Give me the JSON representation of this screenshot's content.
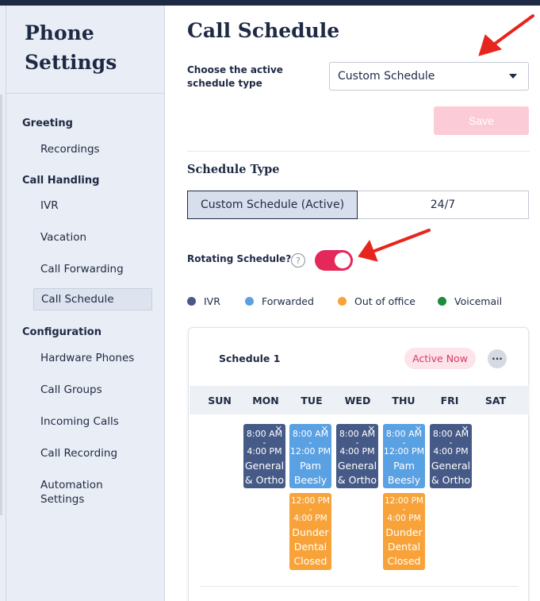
{
  "sidebar": {
    "title": "Phone Settings",
    "sections": [
      {
        "header": "Greeting",
        "items": [
          "Recordings"
        ]
      },
      {
        "header": "Call Handling",
        "items": [
          "IVR",
          "Vacation",
          "Call Forwarding",
          "Call Schedule"
        ]
      },
      {
        "header": "Configuration",
        "items": [
          "Hardware Phones",
          "Call Groups",
          "Incoming Calls",
          "Call Recording",
          "Automation Settings"
        ]
      }
    ],
    "active_item": "Call Schedule"
  },
  "main": {
    "title": "Call Schedule",
    "choose_label": "Choose the active schedule type",
    "select_value": "Custom Schedule",
    "save_label": "Save",
    "schedule_type_heading": "Schedule Type",
    "segments": [
      "Custom Schedule (Active)",
      "24/7"
    ],
    "rotating_label": "Rotating Schedule?",
    "rotating_enabled": true,
    "help_glyph": "?",
    "legend": [
      {
        "label": "IVR",
        "color": "#465a87"
      },
      {
        "label": "Forwarded",
        "color": "#5aa1e3"
      },
      {
        "label": "Out of office",
        "color": "#f7a33a"
      },
      {
        "label": "Voicemail",
        "color": "#1f8a3a"
      }
    ]
  },
  "schedule_card": {
    "title": "Schedule 1",
    "badge": "Active Now",
    "more_glyph": "···",
    "days": [
      "SUN",
      "MON",
      "TUE",
      "WED",
      "THU",
      "FRI",
      "SAT"
    ],
    "blocks": {
      "mon": {
        "start": "8:00 AM",
        "sep": "-",
        "end": "4:00 PM",
        "label1": "General",
        "label2": "& Ortho",
        "type": "IVR"
      },
      "tue1": {
        "start": "8:00 AM",
        "sep": "-",
        "end": "12:00 PM",
        "label1": "Pam",
        "label2": "Beesly",
        "type": "Forwarded"
      },
      "tue2": {
        "start": "12:00 PM",
        "sep": "-",
        "end": "4:00 PM",
        "label1": "Dunder",
        "label2": "Dental",
        "label3": "Closed",
        "type": "Out of office"
      },
      "wed": {
        "start": "8:00 AM",
        "sep": "-",
        "end": "4:00 PM",
        "label1": "General",
        "label2": "& Ortho",
        "type": "IVR"
      },
      "thu1": {
        "start": "8:00 AM",
        "sep": "-",
        "end": "12:00 PM",
        "label1": "Pam",
        "label2": "Beesly",
        "type": "Forwarded"
      },
      "thu2": {
        "start": "12:00 PM",
        "sep": "-",
        "end": "4:00 PM",
        "label1": "Dunder",
        "label2": "Dental",
        "label3": "Closed",
        "type": "Out of office"
      },
      "fri": {
        "start": "8:00 AM",
        "sep": "-",
        "end": "4:00 PM",
        "label1": "General",
        "label2": "& Ortho",
        "type": "IVR"
      }
    },
    "close_glyph": "✕"
  },
  "colors": {
    "navy": "#1e2a44",
    "accent_pink": "#e5285a",
    "save_disabled": "#fbcbd8",
    "annotation_arrow": "#e8251c"
  }
}
